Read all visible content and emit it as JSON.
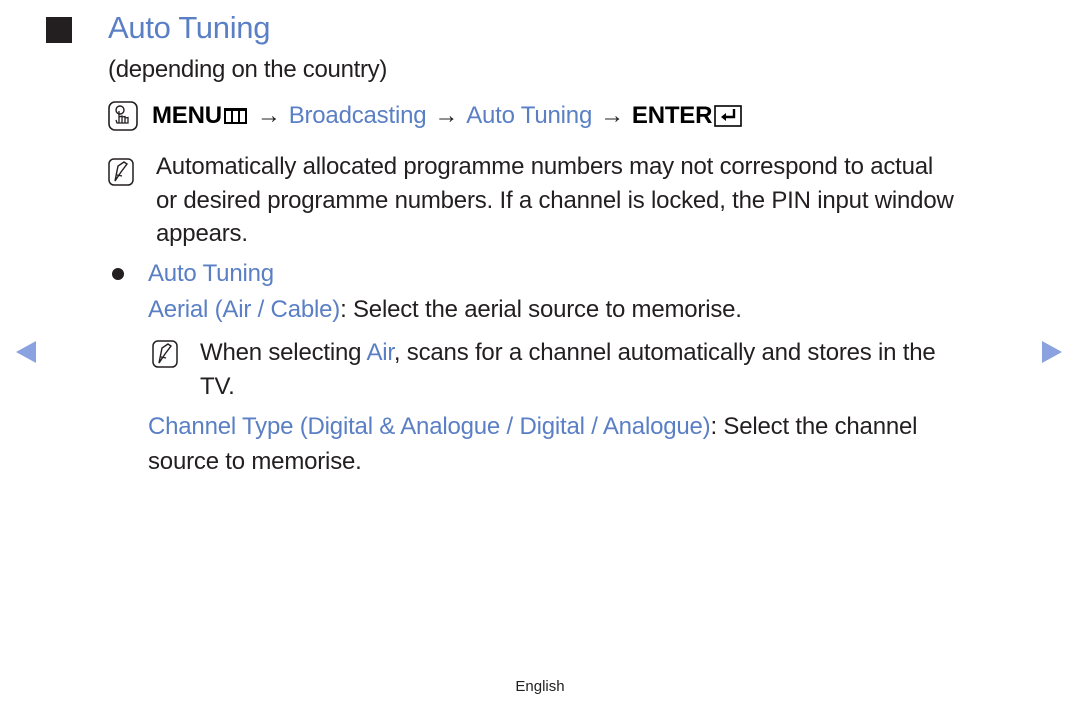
{
  "section": {
    "title": "Auto Tuning",
    "subtitle": "(depending on the country)"
  },
  "menu_path": {
    "menu_label": "MENU",
    "arrow": "→",
    "step1": "Broadcasting",
    "step2": "Auto Tuning",
    "enter_label": "ENTER"
  },
  "note1": {
    "lines": [
      "Automatically allocated programme numbers may not correspond to actual",
      "or desired programme numbers. If a channel is locked, the PIN input window",
      "appears."
    ]
  },
  "bullet": {
    "heading": "Auto Tuning",
    "aerial": {
      "term": "Aerial (Air / Cable)",
      "desc": ": Select the aerial source to memorise."
    },
    "aerial_note": {
      "pre": "When selecting ",
      "term": "Air",
      "post": ", scans for a channel automatically and stores in the",
      "line2": "TV."
    },
    "channel_type": {
      "term": "Channel Type (Digital & Analogue / Digital / Analogue)",
      "desc": ": Select the channel",
      "line2": "source to memorise."
    }
  },
  "navigation": {
    "prev_icon": "triangle-left",
    "next_icon": "triangle-right",
    "color": "#8aa2e0"
  },
  "footer": {
    "language": "English"
  },
  "colors": {
    "accent": "#5a7fc4",
    "text": "#231f20"
  }
}
